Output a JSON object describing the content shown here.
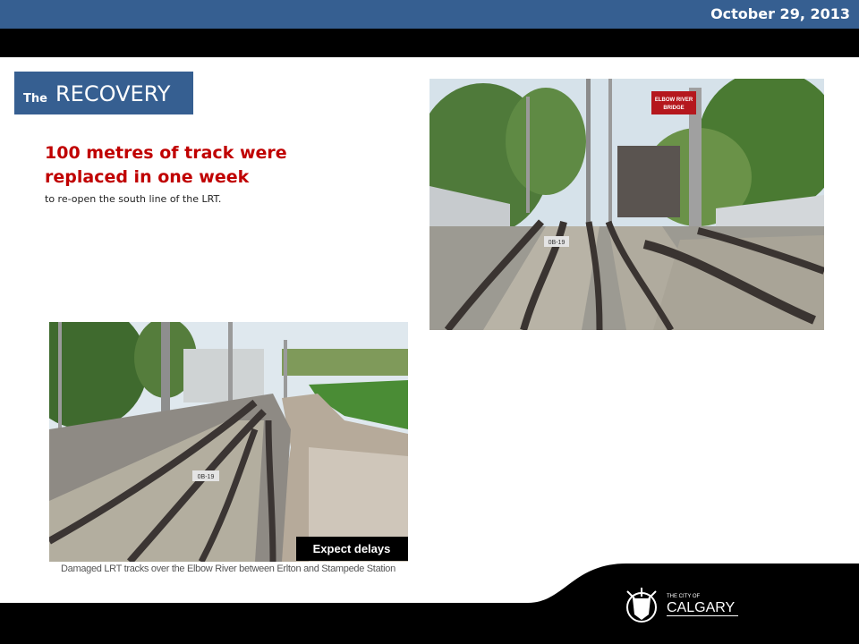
{
  "header": {
    "date": "October 29, 2013"
  },
  "section": {
    "prefix": "The",
    "title": "RECOVERY"
  },
  "headline": "100 metres of track were replaced in one week",
  "subline": "to re-open the south line of the LRT.",
  "photo_right": {
    "sign_line1": "ELBOW RIVER",
    "sign_line2": "BRIDGE",
    "track_label": "0B-19"
  },
  "photo_left": {
    "track_label": "0B-19",
    "banner": "Expect delays",
    "caption": "Damaged LRT tracks over the Elbow River between Erlton and Stampede Station"
  },
  "footer": {
    "logo_small": "THE CITY OF",
    "logo_big": "CALGARY"
  },
  "colors": {
    "brand_blue": "#365f91",
    "headline_red": "#c00000",
    "sign_red": "#b5171d"
  },
  "icons": {
    "crest": "city-crest-icon"
  }
}
